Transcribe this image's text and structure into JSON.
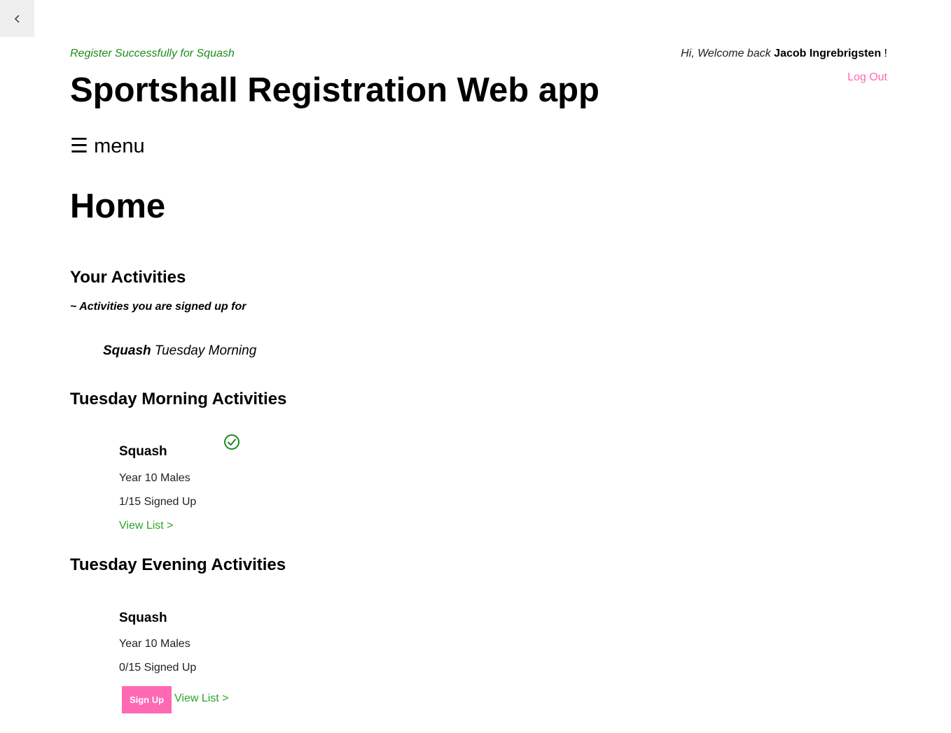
{
  "nav": {
    "back_icon": "chevron-left-icon"
  },
  "header": {
    "flash_message": "Register Successfully for Squash",
    "app_title": "Sportshall Registration Web app",
    "welcome_prefix": "Hi, Welcome back",
    "user_name": "Jacob Ingrebrigsten",
    "welcome_suffix": "!",
    "logout_label": "Log Out",
    "link_color": "#ff69b4"
  },
  "menu": {
    "icon": "hamburger-icon",
    "glyph": "☰",
    "label": "menu"
  },
  "page": {
    "title": "Home"
  },
  "your_activities": {
    "title": "Your Activities",
    "subtitle": "~ Activities you are signed up for",
    "items": [
      {
        "sport": "Squash",
        "session": "Tuesday Morning"
      }
    ]
  },
  "sessions": [
    {
      "title": "Tuesday Morning Activities",
      "activities": [
        {
          "name": "Squash",
          "group": "Year 10 Males",
          "signed_up": "1/15 Signed Up",
          "view_list_label": "View List >",
          "registered": true,
          "status_icon": "check-circle-icon",
          "status_color": "#1e8a1e"
        }
      ]
    },
    {
      "title": "Tuesday Evening Activities",
      "activities": [
        {
          "name": "Squash",
          "group": "Year 10 Males",
          "signed_up": "0/15 Signed Up",
          "view_list_label": "View List >",
          "registered": false,
          "signup_label": "Sign Up"
        }
      ]
    }
  ]
}
